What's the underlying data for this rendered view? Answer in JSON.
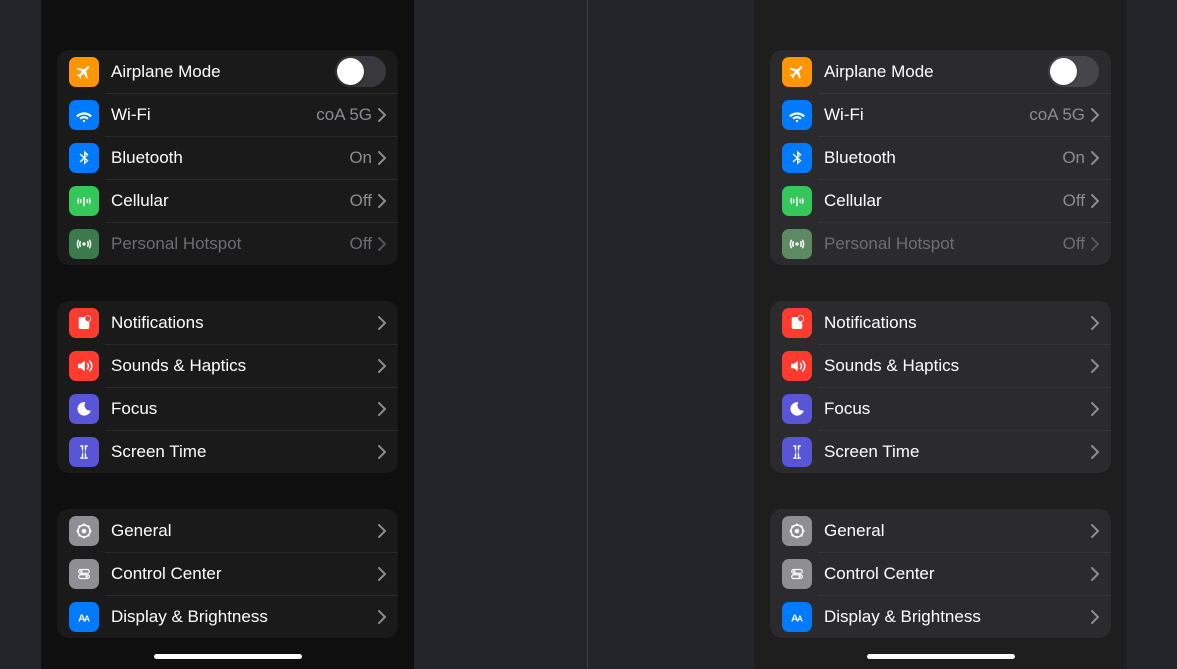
{
  "variants": [
    "dark_black",
    "dark_gray"
  ],
  "groups": [
    [
      {
        "id": "airplane",
        "label": "Airplane Mode",
        "type": "toggle",
        "toggleOn": false,
        "icon": "airplane-icon",
        "iconBg": "bg-orange"
      },
      {
        "id": "wifi",
        "label": "Wi-Fi",
        "value": "coA 5G",
        "type": "link",
        "icon": "wifi-icon",
        "iconBg": "bg-blue"
      },
      {
        "id": "bluetooth",
        "label": "Bluetooth",
        "value": "On",
        "type": "link",
        "icon": "bluetooth-icon",
        "iconBg": "bg-blue"
      },
      {
        "id": "cellular",
        "label": "Cellular",
        "value": "Off",
        "type": "link",
        "icon": "cellular-icon",
        "iconBg": "bg-green"
      },
      {
        "id": "hotspot",
        "label": "Personal Hotspot",
        "value": "Off",
        "type": "link",
        "disabled": true,
        "icon": "hotspot-icon",
        "iconBgLeft": "bg-green-dim",
        "iconBgRight": "bg-hotspot-dim"
      }
    ],
    [
      {
        "id": "notifications",
        "label": "Notifications",
        "type": "link",
        "icon": "notifications-icon",
        "iconBg": "bg-red"
      },
      {
        "id": "sounds",
        "label": "Sounds & Haptics",
        "type": "link",
        "icon": "sounds-icon",
        "iconBg": "bg-red"
      },
      {
        "id": "focus",
        "label": "Focus",
        "type": "link",
        "icon": "focus-icon",
        "iconBg": "bg-indigo"
      },
      {
        "id": "screentime",
        "label": "Screen Time",
        "type": "link",
        "icon": "screentime-icon",
        "iconBg": "bg-indigo"
      }
    ],
    [
      {
        "id": "general",
        "label": "General",
        "type": "link",
        "icon": "general-icon",
        "iconBg": "bg-gray2"
      },
      {
        "id": "controlcenter",
        "label": "Control Center",
        "type": "link",
        "icon": "controlcenter-icon",
        "iconBg": "bg-gray2b"
      },
      {
        "id": "display",
        "label": "Display & Brightness",
        "type": "link",
        "icon": "display-icon",
        "iconBg": "bg-blue"
      }
    ]
  ]
}
